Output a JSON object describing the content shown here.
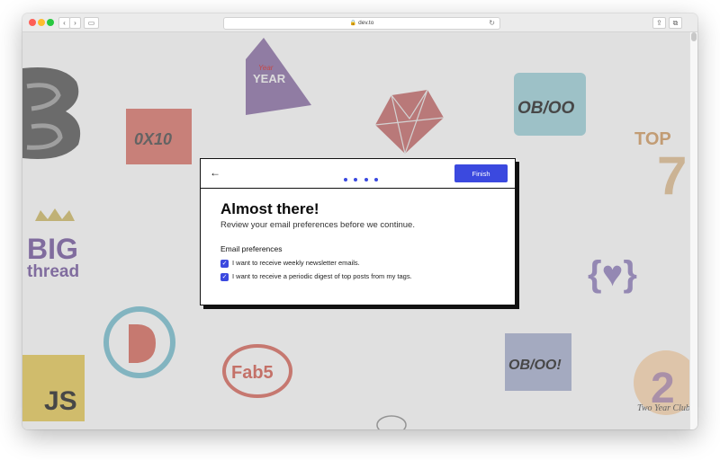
{
  "browser": {
    "address_text": "dev.to"
  },
  "stickers": {
    "year_top": "YEAR",
    "year_small": "Year",
    "oxio": "0X10",
    "oboo": "OB/OO",
    "top": "TOP",
    "seven": "7",
    "big": "BIG",
    "thread": "thread",
    "braces": "{♥}",
    "fab5": "Fab5",
    "js": "JS",
    "oboo2": "OB/OO!",
    "two_year_num": "2",
    "two_year_text": "Two Year Club"
  },
  "modal": {
    "back_icon": "arrow-left-icon",
    "progress_steps": 4,
    "finish_label": "Finish",
    "title": "Almost there!",
    "subtitle": "Review your email preferences before we continue.",
    "section_title": "Email preferences",
    "checkboxes": [
      {
        "label": "I want to receive weekly newsletter emails.",
        "checked": true
      },
      {
        "label": "I want to receive a periodic digest of top posts from my tags.",
        "checked": true
      }
    ]
  },
  "colors": {
    "accent": "#3b49df"
  }
}
